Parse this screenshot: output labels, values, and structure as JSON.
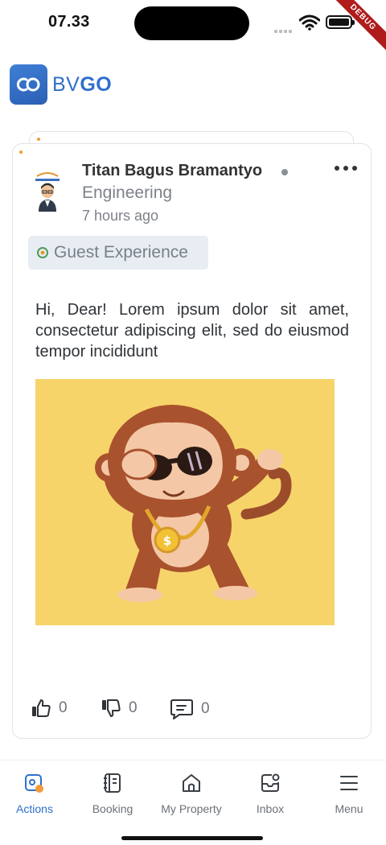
{
  "status_bar": {
    "time": "07.33",
    "debug_label": "DEBUG"
  },
  "header": {
    "brand_light": "BV",
    "brand_bold": "GO"
  },
  "post": {
    "author": "Titan Bagus Bramantyo",
    "department": "Engineering",
    "time_ago": "7 hours ago",
    "tag": "Guest Experience",
    "body": "Hi, Dear! Lorem ipsum dolor sit amet, consectetur adipiscing elit, sed do eiusmod tempor incididunt",
    "likes": "0",
    "dislikes": "0",
    "comments": "0",
    "image": "cartoon-monkey-with-sunglasses-dabbing"
  },
  "nav": {
    "items": [
      {
        "label": "Actions",
        "icon": "actions-icon",
        "active": true
      },
      {
        "label": "Booking",
        "icon": "booking-icon",
        "active": false
      },
      {
        "label": "My Property",
        "icon": "home-icon",
        "active": false
      },
      {
        "label": "Inbox",
        "icon": "inbox-icon",
        "active": false
      },
      {
        "label": "Menu",
        "icon": "menu-icon",
        "active": false
      }
    ]
  },
  "colors": {
    "brand": "#2e6fcb",
    "accent_dot": "#f29b38",
    "image_bg": "#f7d46a",
    "chip_bg": "#e8edf3"
  }
}
